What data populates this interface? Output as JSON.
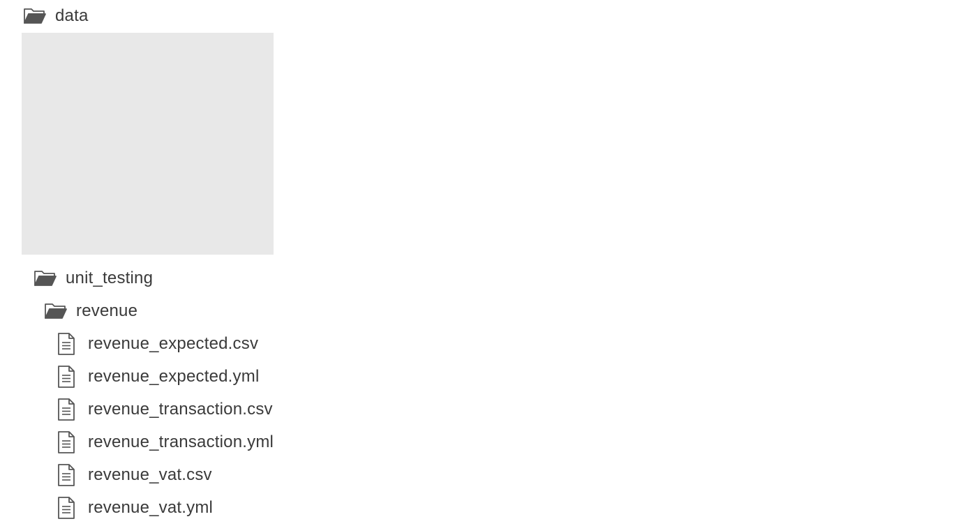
{
  "tree": {
    "root": {
      "label": "data",
      "icon": "folder-open-icon"
    },
    "unit_testing": {
      "label": "unit_testing",
      "icon": "folder-open-icon"
    },
    "revenue": {
      "label": "revenue",
      "icon": "folder-open-icon"
    },
    "files": [
      {
        "label": "revenue_expected.csv",
        "icon": "file-text-icon"
      },
      {
        "label": "revenue_expected.yml",
        "icon": "file-text-icon"
      },
      {
        "label": "revenue_transaction.csv",
        "icon": "file-text-icon"
      },
      {
        "label": "revenue_transaction.yml",
        "icon": "file-text-icon"
      },
      {
        "label": "revenue_vat.csv",
        "icon": "file-text-icon"
      },
      {
        "label": "revenue_vat.yml",
        "icon": "file-text-icon"
      }
    ]
  },
  "colors": {
    "text": "#3a3a3a",
    "icon": "#555555",
    "redacted_block": "#e8e8e8"
  }
}
